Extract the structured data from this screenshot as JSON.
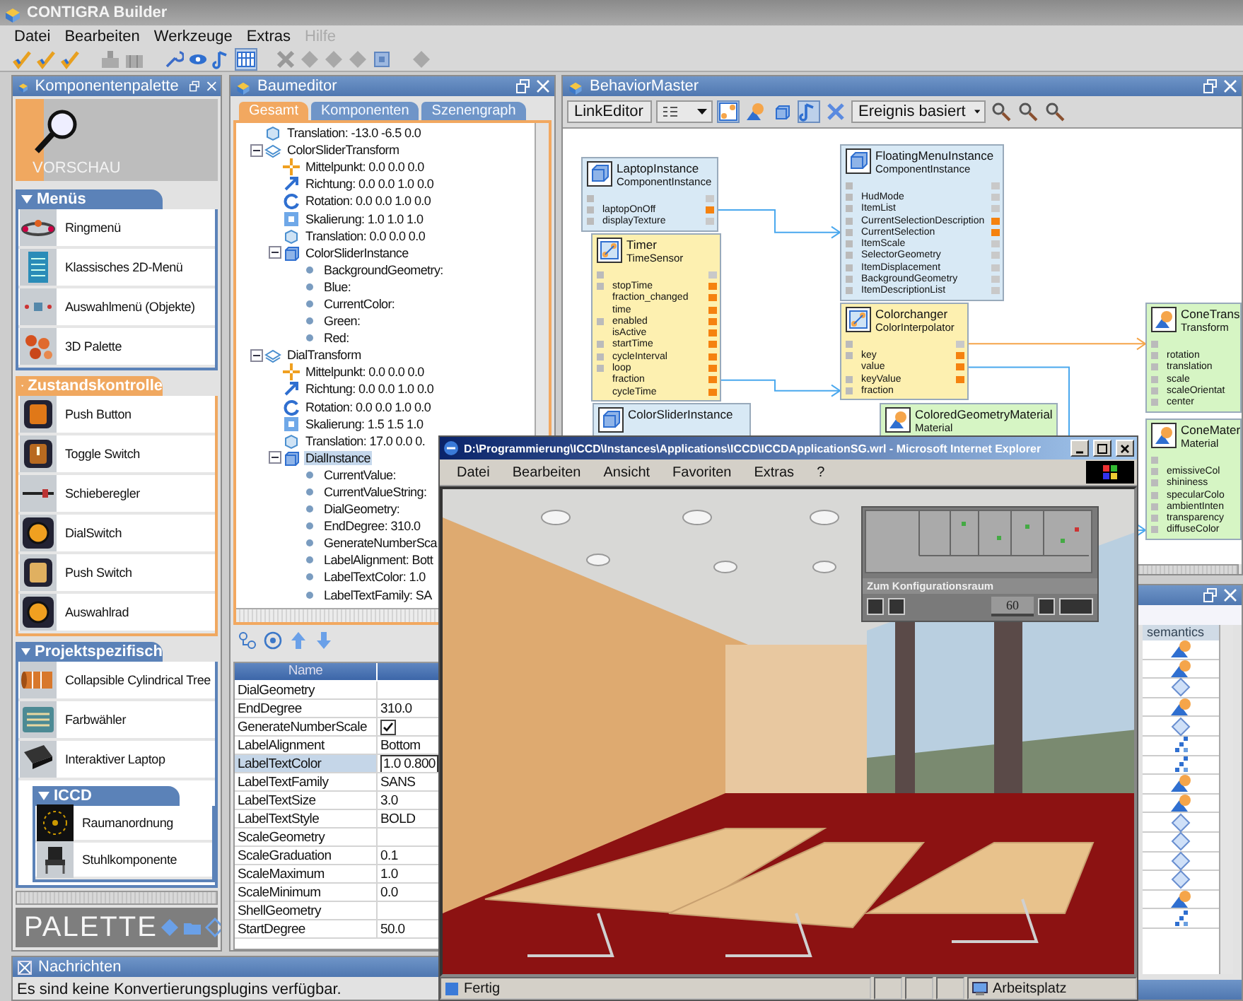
{
  "window": {
    "title": "CONTIGRA Builder"
  },
  "menu": [
    {
      "label": "Datei",
      "disabled": false
    },
    {
      "label": "Bearbeiten",
      "disabled": false
    },
    {
      "label": "Werkzeuge",
      "disabled": false
    },
    {
      "label": "Extras",
      "disabled": false
    },
    {
      "label": "Hilfe",
      "disabled": true
    }
  ],
  "palette": {
    "title": "Komponentenpalette",
    "preview_label": "VORSCHAU",
    "footer_label": "PALETTE",
    "groups": [
      {
        "title": "Menüs",
        "color": "#5b82b8",
        "expanded": true,
        "items": [
          {
            "label": "Ringmenü",
            "kind": "ring"
          },
          {
            "label": "Klassisches 2D-Menü",
            "kind": "menu2d"
          },
          {
            "label": "Auswahlmenü (Objekte)",
            "kind": "selection"
          },
          {
            "label": "3D Palette",
            "kind": "palette3d"
          }
        ]
      },
      {
        "title": "Zustandskontrolle",
        "color": "#f0a860",
        "expanded": true,
        "items": [
          {
            "label": "Push Button",
            "kind": "pushbutton"
          },
          {
            "label": "Toggle Switch",
            "kind": "toggle"
          },
          {
            "label": "Schieberegler",
            "kind": "slider"
          },
          {
            "label": "DialSwitch",
            "kind": "dial"
          },
          {
            "label": "Push Switch",
            "kind": "pushswitch"
          },
          {
            "label": "Auswahlrad",
            "kind": "dial"
          }
        ]
      },
      {
        "title": "Projektspezifisch",
        "color": "#5b82b8",
        "expanded": true,
        "items": [
          {
            "label": "Collapsible Cylindrical Tree",
            "kind": "tree"
          },
          {
            "label": "Farbwähler",
            "kind": "colorpicker"
          },
          {
            "label": "Interaktiver Laptop",
            "kind": "laptop"
          }
        ],
        "subgroups": [
          {
            "title": "ICCD",
            "color": "#5b82b8",
            "expanded": true,
            "items": [
              {
                "label": "Raumanordnung",
                "kind": "layout"
              },
              {
                "label": "Stuhlkomponente",
                "kind": "chair"
              }
            ]
          }
        ]
      }
    ]
  },
  "tree_editor": {
    "title": "Baumeditor",
    "tabs": [
      {
        "label": "Gesamt",
        "selected": true
      },
      {
        "label": "Komponenten",
        "selected": false
      },
      {
        "label": "Szenengraph",
        "selected": false
      }
    ],
    "tree": [
      {
        "label": "Translation: -13.0 -6.5 0.0",
        "kind": "translation",
        "selected": false
      },
      {
        "label": "ColorSliderTransform",
        "kind": "transform",
        "selected": false,
        "expanded": true,
        "children": [
          {
            "label": "Mittelpunkt: 0.0 0.0 0.0",
            "kind": "center",
            "selected": false
          },
          {
            "label": "Richtung: 0.0 0.0 1.0 0.0",
            "kind": "direction",
            "selected": false
          },
          {
            "label": "Rotation: 0.0 0.0 1.0 0.0",
            "kind": "rotation",
            "selected": false
          },
          {
            "label": "Skalierung: 1.0 1.0 1.0",
            "kind": "scale",
            "selected": false
          },
          {
            "label": "Translation: 0.0 0.0 0.0",
            "kind": "translation",
            "selected": false
          },
          {
            "label": "ColorSliderInstance",
            "kind": "instance",
            "selected": false,
            "expanded": true,
            "children": [
              {
                "label": "BackgroundGeometry:",
                "kind": "field",
                "selected": false
              },
              {
                "label": "Blue:",
                "kind": "field",
                "selected": false
              },
              {
                "label": "CurrentColor:",
                "kind": "field",
                "selected": false
              },
              {
                "label": "Green:",
                "kind": "field",
                "selected": false
              },
              {
                "label": "Red:",
                "kind": "field",
                "selected": false
              }
            ]
          }
        ]
      },
      {
        "label": "DialTransform",
        "kind": "transform",
        "selected": false,
        "expanded": true,
        "children": [
          {
            "label": "Mittelpunkt: 0.0 0.0 0.0",
            "kind": "center",
            "selected": false
          },
          {
            "label": "Richtung: 0.0 0.0 1.0 0.0",
            "kind": "direction",
            "selected": false
          },
          {
            "label": "Rotation: 0.0 0.0 1.0 0.0",
            "kind": "rotation",
            "selected": false
          },
          {
            "label": "Skalierung: 1.5 1.5 1.0",
            "kind": "scale",
            "selected": false
          },
          {
            "label": "Translation: 17.0 0.0 0.",
            "kind": "translation",
            "selected": false
          },
          {
            "label": "DialInstance",
            "kind": "instance",
            "selected": true,
            "expanded": true,
            "children": [
              {
                "label": "CurrentValue:",
                "kind": "field",
                "selected": false
              },
              {
                "label": "CurrentValueString:",
                "kind": "field",
                "selected": false
              },
              {
                "label": "DialGeometry:",
                "kind": "field",
                "selected": false
              },
              {
                "label": "EndDegree: 310.0",
                "kind": "field",
                "selected": false
              },
              {
                "label": "GenerateNumberSca",
                "kind": "field",
                "selected": false
              },
              {
                "label": "LabelAlignment: Bott",
                "kind": "field",
                "selected": false
              },
              {
                "label": "LabelTextColor: 1.0",
                "kind": "field",
                "selected": false
              },
              {
                "label": "LabelTextFamily: SA",
                "kind": "field",
                "selected": false
              }
            ]
          }
        ]
      }
    ],
    "properties": {
      "columns": [
        "Name"
      ],
      "rows": [
        {
          "name": "DialGeometry",
          "kind": "text",
          "selected": false
        },
        {
          "name": "EndDegree",
          "value": "310.0",
          "kind": "text",
          "selected": false
        },
        {
          "name": "GenerateNumberScale",
          "kind": "check",
          "checked": true,
          "selected": false
        },
        {
          "name": "LabelAlignment",
          "value": "Bottom",
          "kind": "text",
          "selected": false
        },
        {
          "name": "LabelTextColor",
          "value": "1.0 0.800",
          "kind": "edit",
          "selected": true
        },
        {
          "name": "LabelTextFamily",
          "value": "SANS",
          "kind": "text",
          "selected": false
        },
        {
          "name": "LabelTextSize",
          "value": "3.0",
          "kind": "text",
          "selected": false
        },
        {
          "name": "LabelTextStyle",
          "value": "BOLD",
          "kind": "text",
          "selected": false
        },
        {
          "name": "ScaleGeometry",
          "kind": "text",
          "selected": false
        },
        {
          "name": "ScaleGraduation",
          "value": "0.1",
          "kind": "text",
          "selected": false
        },
        {
          "name": "ScaleMaximum",
          "value": "1.0",
          "kind": "text",
          "selected": false
        },
        {
          "name": "ScaleMinimum",
          "value": "0.0",
          "kind": "text",
          "selected": false
        },
        {
          "name": "ShellGeometry",
          "kind": "text",
          "selected": false
        },
        {
          "name": "StartDegree",
          "value": "50.0",
          "kind": "text",
          "selected": false
        }
      ]
    }
  },
  "messages": {
    "title": "Nachrichten",
    "text": "Es sind keine Konvertierungsplugins verfügbar."
  },
  "behavior": {
    "title": "BehaviorMaster",
    "view_select": "LinkEditor",
    "mode_select": "Ereignis basiert",
    "nodes": [
      {
        "name": "FloatingMenuInstance",
        "type": "ComponentInstance",
        "kind": "instance",
        "header_port": {
          "in": true,
          "out": true,
          "active": false
        },
        "fields": [
          {
            "name": "HudMode",
            "in": true,
            "out": true,
            "active": false
          },
          {
            "name": "ItemList",
            "in": true,
            "out": true,
            "active": false
          },
          {
            "name": "CurrentSelectionDescription",
            "in": true,
            "out": true,
            "active": true
          },
          {
            "name": "CurrentSelection",
            "in": true,
            "out": true,
            "active": true
          },
          {
            "name": "ItemScale",
            "in": true,
            "out": true,
            "active": false
          },
          {
            "name": "SelectorGeometry",
            "in": true,
            "out": true,
            "active": false
          },
          {
            "name": "ItemDisplacement",
            "in": true,
            "out": true,
            "active": false
          },
          {
            "name": "BackgroundGeometry",
            "in": true,
            "out": true,
            "active": false
          },
          {
            "name": "ItemDescriptionList",
            "in": true,
            "out": true,
            "active": false
          }
        ]
      },
      {
        "name": "LaptopInstance",
        "type": "ComponentInstance",
        "kind": "instance",
        "header_port": {
          "in": true,
          "out": true,
          "active": false
        },
        "fields": [
          {
            "name": "laptopOnOff",
            "in": true,
            "out": true,
            "active": true
          },
          {
            "name": "displayTexture",
            "in": true,
            "out": true,
            "active": false
          }
        ]
      },
      {
        "name": "Timer",
        "type": "TimeSensor",
        "kind": "sensor",
        "header_port": {
          "in": true,
          "out": true,
          "active": false
        },
        "fields": [
          {
            "name": "stopTime",
            "in": true,
            "out": true,
            "active": true
          },
          {
            "name": "fraction_changed",
            "in": false,
            "out": true,
            "active": true
          },
          {
            "name": "time",
            "in": false,
            "out": true,
            "active": true
          },
          {
            "name": "enabled",
            "in": true,
            "out": true,
            "active": true
          },
          {
            "name": "isActive",
            "in": false,
            "out": true,
            "active": true
          },
          {
            "name": "startTime",
            "in": true,
            "out": true,
            "active": true
          },
          {
            "name": "cycleInterval",
            "in": true,
            "out": true,
            "active": true
          },
          {
            "name": "loop",
            "in": true,
            "out": true,
            "active": true
          },
          {
            "name": "fraction",
            "in": false,
            "out": true,
            "active": true
          },
          {
            "name": "cycleTime",
            "in": false,
            "out": true,
            "active": true
          }
        ]
      },
      {
        "name": "Colorchanger",
        "type": "ColorInterpolator",
        "kind": "interpolator",
        "header_port": {
          "in": true,
          "out": true,
          "active": false
        },
        "fields": [
          {
            "name": "key",
            "in": true,
            "out": true,
            "active": true
          },
          {
            "name": "value",
            "in": false,
            "out": true,
            "active": true
          },
          {
            "name": "keyValue",
            "in": true,
            "out": true,
            "active": true
          },
          {
            "name": "fraction",
            "in": true,
            "out": false
          }
        ]
      },
      {
        "name": "ConeTrans",
        "type": "Transform",
        "kind": "transform",
        "header_port": {
          "in": true,
          "out": false
        },
        "fields": [
          {
            "name": "rotation",
            "in": true,
            "out": false
          },
          {
            "name": "translation",
            "in": true,
            "out": false
          },
          {
            "name": "scale",
            "in": true,
            "out": false
          },
          {
            "name": "scaleOrientat",
            "in": true,
            "out": false
          },
          {
            "name": "center",
            "in": true,
            "out": false
          }
        ]
      },
      {
        "name": "ColorSliderInstance",
        "kind": "instance"
      },
      {
        "name": "ColoredGeometryMaterial",
        "type": "Material",
        "kind": "material"
      },
      {
        "name": "ConeMater",
        "type": "Material",
        "kind": "material",
        "header_port": {
          "in": true,
          "out": false
        },
        "fields": [
          {
            "name": "emissiveCol",
            "in": true,
            "out": false
          },
          {
            "name": "shininess",
            "in": true,
            "out": false
          },
          {
            "name": "specularColo",
            "in": true,
            "out": false
          },
          {
            "name": "ambientInten",
            "in": true,
            "out": false
          },
          {
            "name": "transparency",
            "in": true,
            "out": false
          },
          {
            "name": "diffuseColor",
            "in": true,
            "out": false
          }
        ]
      }
    ]
  },
  "side_table": {
    "column": "semantics",
    "rows": [
      {
        "kind": "transform"
      },
      {
        "kind": "transform"
      },
      {
        "kind": "material"
      },
      {
        "kind": "transform"
      },
      {
        "kind": "material"
      },
      {
        "kind": "steps"
      },
      {
        "kind": "steps"
      },
      {
        "kind": "transform"
      },
      {
        "kind": "transform"
      },
      {
        "kind": "material"
      },
      {
        "kind": "material"
      },
      {
        "kind": "material"
      },
      {
        "kind": "material"
      },
      {
        "kind": "transform"
      },
      {
        "kind": "steps"
      }
    ]
  },
  "browser": {
    "title": "D:\\Programmierung\\ICCD\\Instances\\Applications\\ICCD\\ICCDApplicationSG.wrl - Microsoft Internet Explorer",
    "menu": [
      "Datei",
      "Bearbeiten",
      "Ansicht",
      "Favoriten",
      "Extras",
      "?"
    ],
    "hud": {
      "caption": "Zum Konfigurationsraum",
      "value": "60"
    },
    "status": "Fertig",
    "zone": "Arbeitsplatz"
  }
}
